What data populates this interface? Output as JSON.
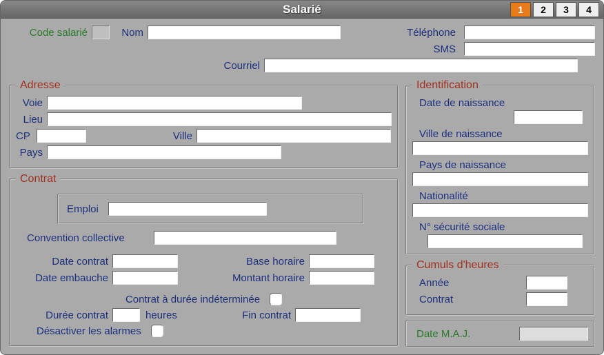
{
  "title": "Salarié",
  "tabs": [
    "1",
    "2",
    "3",
    "4"
  ],
  "labels": {
    "code_salarie": "Code salarié",
    "nom": "Nom",
    "telephone": "Téléphone",
    "sms": "SMS",
    "courriel": "Courriel",
    "adresse": "Adresse",
    "voie": "Voie",
    "lieu": "Lieu",
    "cp": "CP",
    "ville": "Ville",
    "pays": "Pays",
    "contrat": "Contrat",
    "emploi": "Emploi",
    "convention": "Convention collective",
    "date_contrat": "Date contrat",
    "date_embauche": "Date embauche",
    "base_horaire": "Base horaire",
    "montant_horaire": "Montant horaire",
    "cdi": "Contrat à durée indéterminée",
    "duree_contrat": "Durée contrat",
    "heures": "heures",
    "fin_contrat": "Fin contrat",
    "desactiver_alarmes": "Désactiver les alarmes",
    "identification": "Identification",
    "date_naissance": "Date de naissance",
    "ville_naissance": "Ville de naissance",
    "pays_naissance": "Pays de naissance",
    "nationalite": "Nationalité",
    "secu": "N° sécurité sociale",
    "cumuls": "Cumuls d'heures",
    "annee": "Année",
    "contrat_h": "Contrat",
    "date_maj": "Date M.A.J."
  },
  "values": {
    "code_salarie": "",
    "nom": "",
    "telephone": "",
    "sms": "",
    "courriel": "",
    "voie": "",
    "lieu": "",
    "cp": "",
    "ville": "",
    "pays": "",
    "emploi": "",
    "convention": "",
    "date_contrat": "",
    "date_embauche": "",
    "base_horaire": "",
    "montant_horaire": "",
    "duree_contrat": "",
    "fin_contrat": "",
    "date_naissance": "",
    "ville_naissance": "",
    "pays_naissance": "",
    "nationalite": "",
    "secu": "",
    "annee": "",
    "contrat_h": "",
    "date_maj": ""
  }
}
